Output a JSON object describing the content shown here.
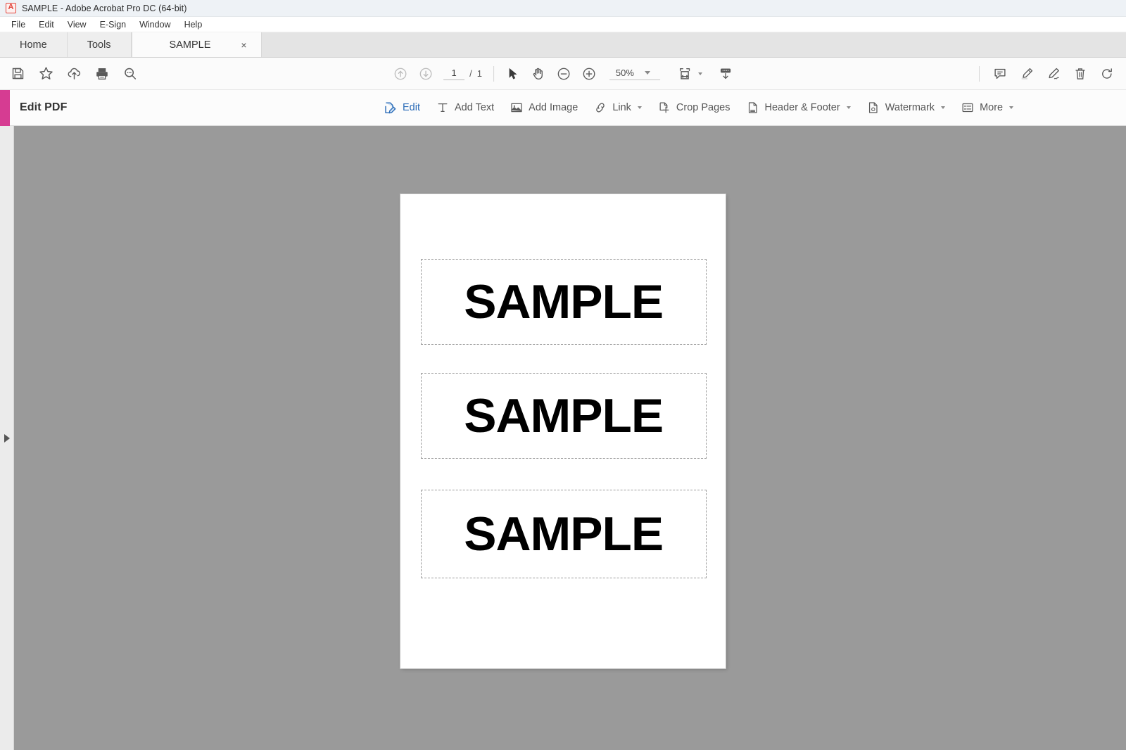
{
  "window": {
    "title": "SAMPLE - Adobe Acrobat Pro DC (64-bit)",
    "logo_icon": "acrobat-logo-icon"
  },
  "menubar": {
    "items": [
      {
        "label": "File"
      },
      {
        "label": "Edit"
      },
      {
        "label": "View"
      },
      {
        "label": "E-Sign"
      },
      {
        "label": "Window"
      },
      {
        "label": "Help"
      }
    ]
  },
  "tabs": {
    "home": "Home",
    "tools": "Tools",
    "document": "SAMPLE",
    "close_glyph": "×"
  },
  "toolbar": {
    "left_icons": [
      {
        "name": "save-icon",
        "title": "Save File"
      },
      {
        "name": "star-icon",
        "title": "Add to Favorites"
      },
      {
        "name": "cloud-upload-icon",
        "title": "Save to Cloud"
      },
      {
        "name": "print-icon",
        "title": "Print File"
      },
      {
        "name": "search-icon",
        "title": "Find"
      }
    ],
    "previous_page_icon": "arrow-up-circle-icon",
    "next_page_icon": "arrow-down-circle-icon",
    "page_current": "1",
    "page_separator": "/",
    "page_total": "1",
    "select_tool_icon": "cursor-arrow-icon",
    "hand_tool_icon": "hand-icon",
    "zoom_out_icon": "zoom-out-icon",
    "zoom_in_icon": "zoom-in-icon",
    "zoom_level": "50%",
    "fit_page_icon": "fit-page-icon",
    "scroll_mode_icon": "scroll-down-icon",
    "right_icons": [
      {
        "name": "comment-icon",
        "title": "Add Comment"
      },
      {
        "name": "highlight-icon",
        "title": "Highlight Text"
      },
      {
        "name": "sign-icon",
        "title": "Fill & Sign"
      },
      {
        "name": "delete-icon",
        "title": "Delete Pages"
      },
      {
        "name": "rotate-icon",
        "title": "Rotate Pages"
      }
    ]
  },
  "edit_pdf": {
    "title": "Edit PDF",
    "accent_color": "#d63c92",
    "active_color": "#2b6cb8",
    "tools": [
      {
        "label": "Edit",
        "icon": "edit-pdf-icon",
        "active": true,
        "has_caret": false
      },
      {
        "label": "Add Text",
        "icon": "add-text-icon",
        "active": false,
        "has_caret": false
      },
      {
        "label": "Add Image",
        "icon": "add-image-icon",
        "active": false,
        "has_caret": false
      },
      {
        "label": "Link",
        "icon": "link-icon",
        "active": false,
        "has_caret": true
      },
      {
        "label": "Crop Pages",
        "icon": "crop-pages-icon",
        "active": false,
        "has_caret": false
      },
      {
        "label": "Header & Footer",
        "icon": "header-footer-icon",
        "active": false,
        "has_caret": true
      },
      {
        "label": "Watermark",
        "icon": "watermark-icon",
        "active": false,
        "has_caret": true
      },
      {
        "label": "More",
        "icon": "more-list-icon",
        "active": false,
        "has_caret": true
      }
    ]
  },
  "document": {
    "background_color": "#9a9a9a",
    "page_color": "#ffffff",
    "nav_panel_toggle_icon": "chevron-right-icon",
    "text_blocks": [
      {
        "text": "SAMPLE"
      },
      {
        "text": "SAMPLE"
      },
      {
        "text": "SAMPLE"
      }
    ]
  }
}
